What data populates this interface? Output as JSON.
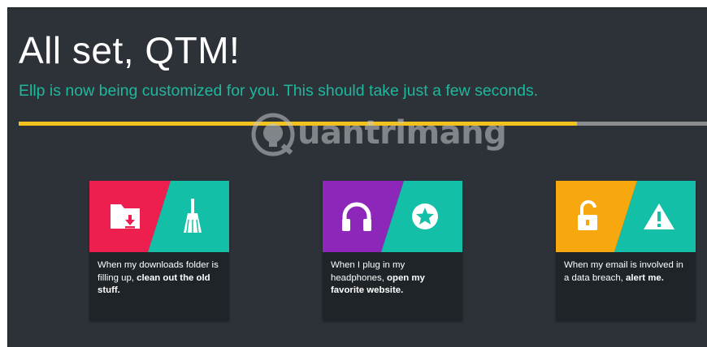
{
  "header": {
    "title": "All set, QTM!",
    "subtitle": "Ellp is now being customized for you. This should take just a few seconds."
  },
  "progress": {
    "percent": 81,
    "fill_color": "#f1c21b",
    "track_color": "#8b8d8f"
  },
  "watermark": {
    "text": "uantrimang"
  },
  "colors": {
    "background": "#2d3239",
    "accent_teal": "#13bfa6",
    "title": "#ffffff",
    "subtitle": "#1fb89d"
  },
  "cards": [
    {
      "left_color": "#ec1f4f",
      "right_color": "#13bfa6",
      "left_icon": "download-folder-icon",
      "right_icon": "broom-icon",
      "text": "When my downloads folder is filling up, ",
      "action": "clean out the old stuff."
    },
    {
      "left_color": "#8d27b9",
      "right_color": "#13bfa6",
      "left_icon": "headphones-icon",
      "right_icon": "star-badge-icon",
      "text": "When I plug in my headphones, ",
      "action": "open my favorite website."
    },
    {
      "left_color": "#f6a80e",
      "right_color": "#13bfa6",
      "left_icon": "unlock-icon",
      "right_icon": "warning-icon",
      "text": "When my email is involved in a data breach, ",
      "action": "alert me."
    }
  ]
}
